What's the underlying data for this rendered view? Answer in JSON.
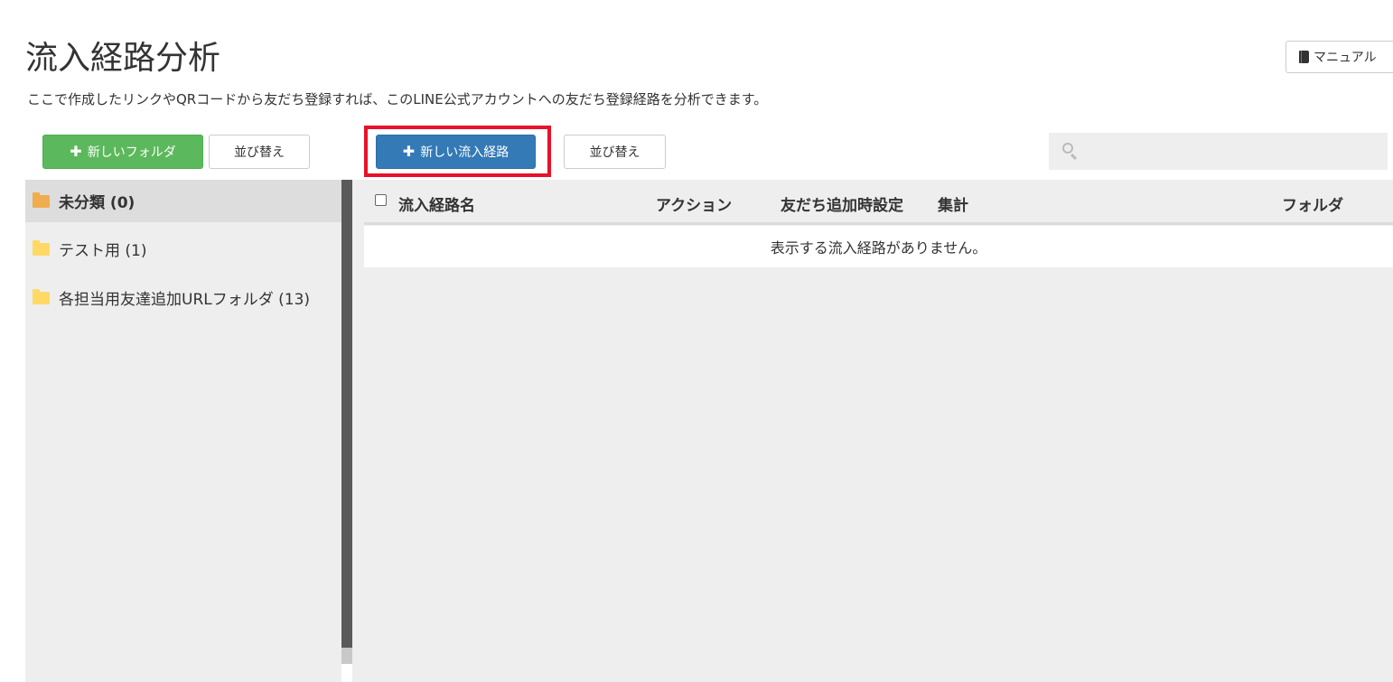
{
  "header": {
    "title": "流入経路分析",
    "description": "ここで作成したリンクやQRコードから友だち登録すれば、このLINE公式アカウントへの友だち登録経路を分析できます。",
    "manual_label": "マニュアル"
  },
  "toolbar": {
    "new_folder_label": "新しいフォルダ",
    "sort_folder_label": "並び替え",
    "new_route_label": "新しい流入経路",
    "sort_route_label": "並び替え",
    "search_placeholder": ""
  },
  "sidebar": {
    "folders": [
      {
        "label": "未分類 (0)",
        "active": true
      },
      {
        "label": "テスト用 (1)",
        "active": false
      },
      {
        "label": "各担当用友達追加URLフォルダ (13)",
        "active": false
      }
    ]
  },
  "table": {
    "columns": {
      "name": "流入経路名",
      "action": "アクション",
      "friend_setting": "友だち追加時設定",
      "aggregate": "集計",
      "folder": "フォルダ"
    },
    "empty_message": "表示する流入経路がありません。"
  },
  "colors": {
    "green": "#5cb85c",
    "blue": "#337ab7",
    "highlight": "#e8102a",
    "folder_active": "#f0ad4e",
    "folder": "#ffd966"
  }
}
